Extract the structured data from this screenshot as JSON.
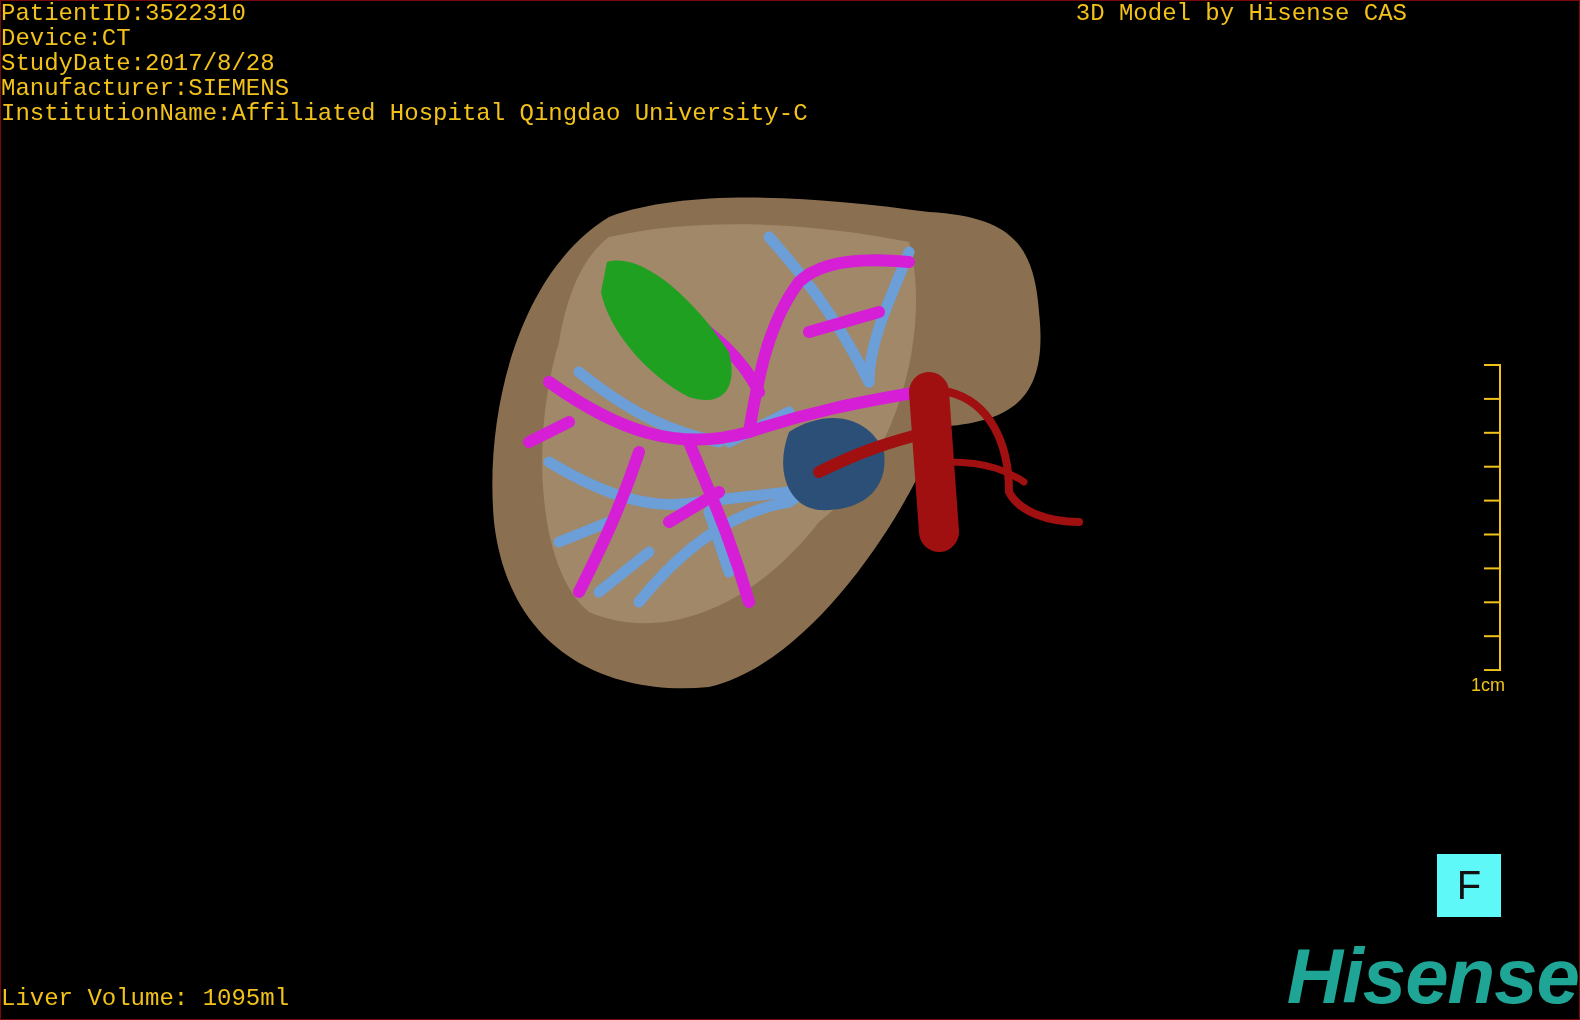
{
  "info_lines": [
    "PatientID:3522310",
    "Device:CT",
    "StudyDate:2017/8/28",
    "Manufacturer:SIEMENS",
    "InstitutionName:Affiliated Hospital Qingdao University-C"
  ],
  "title": "3D Model by Hisense CAS",
  "scale_bar": {
    "label": "1cm"
  },
  "view_button": {
    "label": "F"
  },
  "liver_volume": "Liver Volume: 1095ml",
  "logo": "Hisense"
}
